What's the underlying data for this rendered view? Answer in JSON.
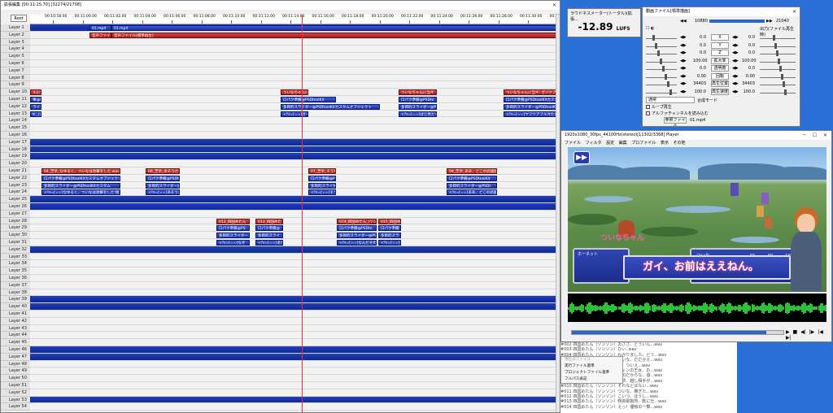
{
  "timeline": {
    "title": "拡張編集 [00:11:15.70] [32274/21708]",
    "root_label": "Root",
    "ticks": [
      "00:10:58.00",
      "00:11:00.00",
      "00:11:02.00",
      "00:11:04.00",
      "00:11:06.00",
      "00:11:08.00",
      "00:11:10.00",
      "00:11:12.00",
      "00:11:14.00",
      "00:11:16.00",
      "00:11:18.00",
      "00:11:20.00",
      "00:11:22.00",
      "00:11:24.00",
      "00:11:26.00",
      "00:11:28.00",
      "00:11:30.00",
      "00:11:32.00"
    ],
    "layers": [
      "Layer 1",
      "Layer 2",
      "Layer 3",
      "Layer 4",
      "Layer 5",
      "Layer 6",
      "Layer 7",
      "Layer 8",
      "Layer 9",
      "Layer 10",
      "Layer 11",
      "Layer 12",
      "Layer 13",
      "Layer 14",
      "Layer 15",
      "Layer 16",
      "Layer 17",
      "Layer 18",
      "Layer 19",
      "Layer 20",
      "Layer 21",
      "Layer 22",
      "Layer 23",
      "Layer 24",
      "Layer 25",
      "Layer 26",
      "Layer 27",
      "Layer 28",
      "Layer 29",
      "Layer 30",
      "Layer 31",
      "Layer 32",
      "Layer 33",
      "Layer 34",
      "Layer 35",
      "Layer 36",
      "Layer 37",
      "Layer 38",
      "Layer 39",
      "Layer 40",
      "Layer 41",
      "Layer 42",
      "Layer 43",
      "Layer 44",
      "Layer 45",
      "Layer 46",
      "Layer 47",
      "Layer 48",
      "Layer 49",
      "Layer 50",
      "Layer 51",
      "Layer 52",
      "Layer 53",
      "Layer 54"
    ],
    "dark_layers": [
      1,
      17,
      18,
      19,
      25,
      26,
      32,
      39,
      40,
      46,
      47,
      53
    ],
    "objects": [
      {
        "layer": 1,
        "start": 109,
        "end": 136,
        "text": "01.mp4",
        "color": "blue"
      },
      {
        "layer": 1,
        "start": 136,
        "end": 684,
        "text": "01.mp4",
        "color": "blue"
      },
      {
        "layer": 2,
        "start": 109,
        "end": 136,
        "text": "音声ファイル[標",
        "color": "red"
      },
      {
        "layer": 2,
        "start": 136,
        "end": 684,
        "text": "音声ファイル[標準再生]",
        "color": "red"
      },
      {
        "layer": 10,
        "start": 36,
        "end": 50,
        "text": "ルに全",
        "color": "red"
      },
      {
        "layer": 11,
        "start": 36,
        "end": 50,
        "text": "事@PSD",
        "color": "blue"
      },
      {
        "layer": 12,
        "start": 36,
        "end": 50,
        "text": "ライダー",
        "color": "blue"
      },
      {
        "layer": 13,
        "start": 36,
        "end": 50,
        "text": "lt:_(口",
        "color": "blue"
      },
      {
        "layer": 10,
        "start": 344,
        "end": 378,
        "text": "ついなちゃんに当",
        "color": "red"
      },
      {
        "layer": 11,
        "start": 344,
        "end": 412,
        "text": "口パク準備@PSDtoolKit",
        "color": "blue"
      },
      {
        "layer": 12,
        "start": 344,
        "end": 466,
        "text": "多目的スライダー@PSDtoolKitカスタムオブジェクト",
        "color": "blue"
      },
      {
        "layer": 13,
        "start": 344,
        "end": 378,
        "text": "<?s=[==[ガイ",
        "color": "blue"
      },
      {
        "layer": 10,
        "start": 489,
        "end": 536,
        "text": "ついなちゃんに当ギ",
        "color": "red"
      },
      {
        "layer": 11,
        "start": 489,
        "end": 536,
        "text": "口パク準備@PSDto",
        "color": "blue"
      },
      {
        "layer": 12,
        "start": 489,
        "end": 536,
        "text": "多目的スライダー@PSD",
        "color": "blue"
      },
      {
        "layer": 13,
        "start": 489,
        "end": 536,
        "text": "<?s=[==[ばじ見たら",
        "color": "blue"
      },
      {
        "layer": 10,
        "start": 618,
        "end": 684,
        "text": "ついなちゃんに当ギ: ガゾケアがオ",
        "color": "red"
      },
      {
        "layer": 11,
        "start": 618,
        "end": 684,
        "text": "口パク準備@PSDtoolKitカスタ",
        "color": "blue"
      },
      {
        "layer": 12,
        "start": 618,
        "end": 684,
        "text": "多目的スライダー@PSDtoolKi",
        "color": "blue"
      },
      {
        "layer": 13,
        "start": 618,
        "end": 684,
        "text": "<?s=[==[ヤフツアフル冷たい",
        "color": "blue"
      },
      {
        "layer": 21,
        "start": 50,
        "end": 147,
        "text": "04_芝亭_なゆるく、ついなは攻撃をした.wav",
        "color": "red"
      },
      {
        "layer": 22,
        "start": 50,
        "end": 147,
        "text": "口パク準備@PSDtoolKitカスタムオブジェクト",
        "color": "blue"
      },
      {
        "layer": 23,
        "start": 50,
        "end": 147,
        "text": "多目的スライダー@PSDtoolKitカスタム",
        "color": "blue"
      },
      {
        "layer": 24,
        "start": 50,
        "end": 147,
        "text": "<?s=[==[なゆるく、ついなは攻撃をした!仮令",
        "color": "blue"
      },
      {
        "layer": 21,
        "start": 178,
        "end": 220,
        "text": "06_芝亭_あそうだ.",
        "color": "red"
      },
      {
        "layer": 22,
        "start": 178,
        "end": 220,
        "text": "口パク準備@PSDto",
        "color": "blue"
      },
      {
        "layer": 23,
        "start": 178,
        "end": 220,
        "text": "多目的スライダー@PSD",
        "color": "blue"
      },
      {
        "layer": 24,
        "start": 178,
        "end": 220,
        "text": "<?s=[==[あそうだ.",
        "color": "blue"
      },
      {
        "layer": 21,
        "start": 378,
        "end": 412,
        "text": "07_芝亭_そうだ",
        "color": "red"
      },
      {
        "layer": 22,
        "start": 378,
        "end": 412,
        "text": "口パク準備@PS",
        "color": "blue"
      },
      {
        "layer": 23,
        "start": 378,
        "end": 412,
        "text": "多目的スライダー",
        "color": "blue"
      },
      {
        "layer": 24,
        "start": 378,
        "end": 412,
        "text": "<?s=[==[そうだ",
        "color": "blue"
      },
      {
        "layer": 21,
        "start": 548,
        "end": 610,
        "text": "08_芝亭_ああ、どこの武器屋",
        "color": "red"
      },
      {
        "layer": 22,
        "start": 548,
        "end": 610,
        "text": "口パク準備@PSDtoolKit",
        "color": "blue"
      },
      {
        "layer": 23,
        "start": 548,
        "end": 610,
        "text": "多目的スライダー@PSDt",
        "color": "blue"
      },
      {
        "layer": 24,
        "start": 548,
        "end": 610,
        "text": "<?s=[==[ああ、どこの武器",
        "color": "blue"
      },
      {
        "layer": 28,
        "start": 265,
        "end": 306,
        "text": "012_四国めたん",
        "color": "red"
      },
      {
        "layer": 29,
        "start": 265,
        "end": 306,
        "text": "口パク準備@PS",
        "color": "blue"
      },
      {
        "layer": 30,
        "start": 265,
        "end": 306,
        "text": "多目的スライダー",
        "color": "blue"
      },
      {
        "layer": 31,
        "start": 265,
        "end": 306,
        "text": "<?s=[==[なぞ",
        "color": "blue"
      },
      {
        "layer": 28,
        "start": 313,
        "end": 347,
        "text": "013_四国めた",
        "color": "red"
      },
      {
        "layer": 29,
        "start": 313,
        "end": 347,
        "text": "口パク準備@",
        "color": "blue"
      },
      {
        "layer": 30,
        "start": 313,
        "end": 347,
        "text": "多目的スライ",
        "color": "blue"
      },
      {
        "layer": 31,
        "start": 313,
        "end": 347,
        "text": "<?s=[==[あた",
        "color": "blue"
      },
      {
        "layer": 28,
        "start": 413,
        "end": 462,
        "text": "014_四国めたん_(ソン",
        "color": "red"
      },
      {
        "layer": 29,
        "start": 413,
        "end": 462,
        "text": "口パク準備@PSDto",
        "color": "blue"
      },
      {
        "layer": 30,
        "start": 413,
        "end": 462,
        "text": "多目的スライダー@PSD",
        "color": "blue"
      },
      {
        "layer": 31,
        "start": 413,
        "end": 462,
        "text": "<?s=[==[なんだその",
        "color": "blue"
      },
      {
        "layer": 28,
        "start": 464,
        "end": 492,
        "text": "015_四国め",
        "color": "red"
      },
      {
        "layer": 29,
        "start": 464,
        "end": 492,
        "text": "口パク準備",
        "color": "blue"
      },
      {
        "layer": 30,
        "start": 464,
        "end": 492,
        "text": "多目的スラ",
        "color": "blue"
      },
      {
        "layer": 31,
        "start": 464,
        "end": 492,
        "text": "<?s=[==[何",
        "color": "blue"
      }
    ]
  },
  "loudness": {
    "title": "ラウドネスメーター(トータル)(拡張...",
    "value": "-12.89",
    "unit": "LUFS"
  },
  "property": {
    "title": "動画ファイル[標準描画]",
    "frame_left": "10880",
    "frame_right": "21040",
    "mode": "出力(ファイル再生時)",
    "rows": [
      {
        "label": "X",
        "v1": "0.0",
        "v2": "0.0"
      },
      {
        "label": "Y",
        "v1": "0.0",
        "v2": "0.0"
      },
      {
        "label": "Z",
        "v1": "0.0",
        "v2": "0.0"
      },
      {
        "label": "拡大率",
        "v1": "100.00",
        "v2": "100.00"
      },
      {
        "label": "透明度",
        "v1": "0.0",
        "v2": "0.0"
      },
      {
        "label": "回転",
        "v1": "0.00",
        "v2": "0.00"
      },
      {
        "label": "再生位置",
        "v1": "34403",
        "v2": "34403"
      },
      {
        "label": "再生速度",
        "v1": "100.0",
        "v2": "100.0"
      }
    ],
    "blend": "通常",
    "blend_right": "合成モード",
    "loop": "ループ再生",
    "alpha": "アルファチャンネルを読み込む",
    "ref_button": "参照ファイル",
    "filename": "01.mp4"
  },
  "player": {
    "title": "1920x1080_30fps_44100Hz(stereo)[11302/3368] Player",
    "menu": [
      "ファイル",
      "フィルタ",
      "設定",
      "編集",
      "プロファイル",
      "表示",
      "その他"
    ],
    "ff_icon": "▶▶",
    "enemy_name": "ついなちゃん",
    "status_left_label": "ホーネット",
    "status_rows": [
      {
        "name": "ついな",
        "a": "40",
        "b": "40",
        "c": "10"
      },
      {
        "name": "めたん",
        "a": "40",
        "b": "9",
        "c": "10"
      },
      {
        "name": "ずんだ",
        "a": "40",
        "b": "40",
        "c": "10"
      }
    ],
    "subtitle": "ガイ、お前はええねん。",
    "buttons": [
      "▶",
      "■",
      "◀|",
      "|▶",
      "|◀",
      "▶|"
    ]
  },
  "context_menu": {
    "items": [
      "現在のファイル",
      "実行ファイル基準",
      "プロジェクトファイル基準",
      "フルパス表記"
    ]
  },
  "script_lines": [
    "#002 四国めたん（ソンソン）おささ、とういん...wav",
    "#003 四国めたん（ソンソン）ひぃ..wav",
    "#004 四国めたん（ソンソン）わかりました、どう...wav",
    "#005 四国めたん（ソンソン）ついな、だだかえ...wav",
    "#006 四国めたん（ソンソン）あ、ついえ...wav",
    "#007 四国めたん（ソンソン）フィンの王女、お...wav",
    "#008 四国めたん（ソンソン）俺のだからな、遊...wav",
    "#009 四国めたん（ソンソン）最終、越し相手が...wav",
    "#010 四国めたん（ソンソン）それなどばない...wav",
    "#011 四国めたん（ソンソン）ついな、勝ぎた...wav",
    "#012 四国めたん（ソンソン）こいつ、ほうし...wav",
    "#013 四国めたん（ソンソン）物資取扱所。転に仕...wav",
    "#014 四国めたん（ソンソン）えっ！優喰の一撃...wav"
  ]
}
